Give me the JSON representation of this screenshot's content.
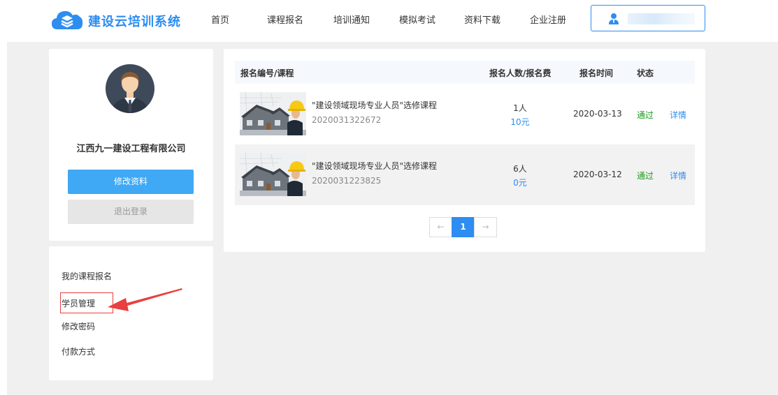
{
  "header": {
    "logo_text": "建设云培训系统",
    "nav": [
      {
        "label": "首页"
      },
      {
        "label": "课程报名"
      },
      {
        "label": "培训通知"
      },
      {
        "label": "模拟考试"
      },
      {
        "label": "资料下载"
      },
      {
        "label": "企业注册"
      }
    ],
    "user_icon": "user-icon"
  },
  "profile": {
    "company": "江西九一建设工程有限公司",
    "edit_label": "修改资料",
    "logout_label": "退出登录"
  },
  "menu": {
    "items": [
      {
        "label": "我的课程报名"
      },
      {
        "label": "学员管理"
      },
      {
        "label": "修改密码"
      },
      {
        "label": "付款方式"
      }
    ]
  },
  "table": {
    "headers": {
      "course": "报名编号/课程",
      "count_fee": "报名人数/报名费",
      "time": "报名时间",
      "status": "状态"
    },
    "rows": [
      {
        "title": "\"建设领域现场专业人员\"选修课程",
        "number": "2020031322672",
        "count": "1人",
        "fee": "10元",
        "date": "2020-03-13",
        "status": "通过",
        "detail": "详情"
      },
      {
        "title": "\"建设领域现场专业人员\"选修课程",
        "number": "2020031223825",
        "count": "6人",
        "fee": "0元",
        "date": "2020-03-12",
        "status": "通过",
        "detail": "详情"
      }
    ]
  },
  "pager": {
    "prev": "←",
    "current": "1",
    "next": "→"
  },
  "colors": {
    "accent": "#2d8df0",
    "button": "#3fa9f5",
    "status_pass": "#1a9c1a",
    "annotation": "#e84040"
  }
}
